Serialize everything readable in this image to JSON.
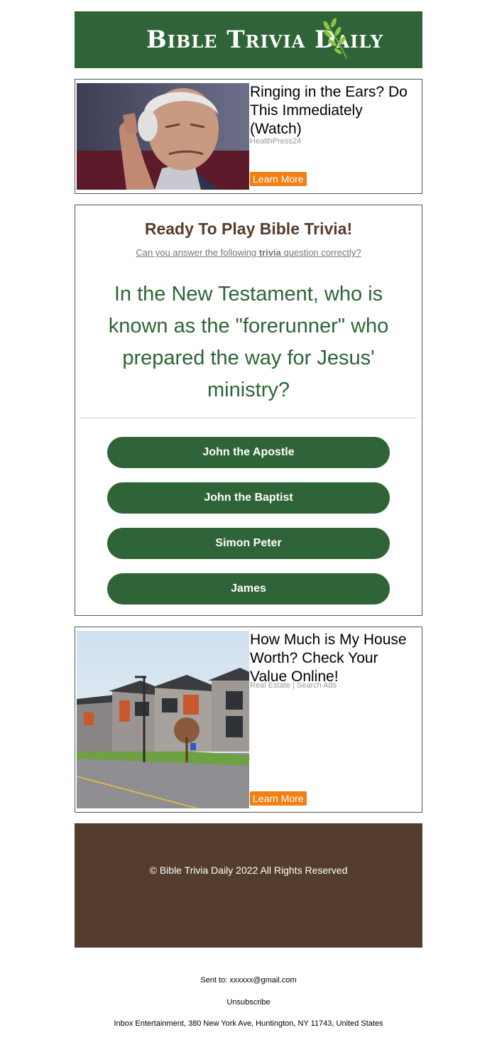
{
  "header": {
    "logo_text": "Bible Trivia Daily",
    "brand_color": "#2e6437"
  },
  "ads": [
    {
      "title": "Ringing in the Ears? Do This Immediately (Watch)",
      "source": "HealthPress24",
      "button": "Learn More",
      "image": "elderly-man-holding-ear-photo"
    },
    {
      "title": "How Much is My House Worth? Check Your Value Online!",
      "source": "Real Estate | Search Ads",
      "button": "Learn More",
      "image": "modern-townhouses-photo"
    }
  ],
  "trivia": {
    "title": "Ready To Play Bible Trivia!",
    "subtitle_pre": "Can you answer the following ",
    "subtitle_bold": "trivia",
    "subtitle_post": " question correctly?",
    "question": "In the New Testament, who is known as the \"forerunner\" who prepared the way for Jesus' ministry?",
    "answers": [
      "John the Apostle",
      "John the Baptist",
      "Simon Peter",
      "James"
    ]
  },
  "footer": {
    "copyright": "© Bible Trivia Daily 2022 All Rights Reserved",
    "background": "#553d2d"
  },
  "meta": {
    "sent_to": "Sent to: xxxxxx@gmail.com",
    "unsubscribe": "Unsubscribe",
    "address": "Inbox Entertainment, 380 New York Ave, Huntington, NY 11743, United States"
  },
  "colors": {
    "accent_orange": "#f08014",
    "question_green": "#2e6437",
    "title_brown": "#563d2d"
  }
}
